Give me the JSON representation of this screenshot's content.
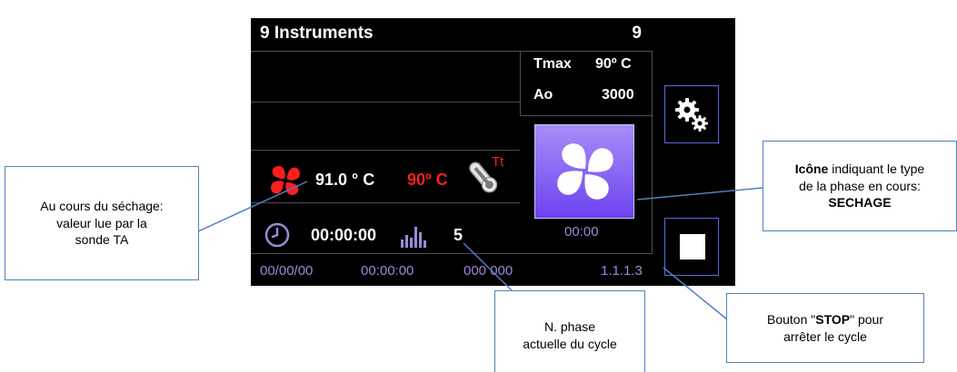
{
  "screen": {
    "title": "9 Instruments",
    "count": "9",
    "tmax_label": "Tmax",
    "tmax_value": "90º C",
    "ao_label": "Ao",
    "ao_value": "3000",
    "phase_time": "00:00",
    "temp_read": "91.0 ° C",
    "temp_set": "90º C",
    "probe_label": "Tt",
    "cycle_time": "00:00:00",
    "phase_number": "5",
    "status_date": "00/00/00",
    "status_time": "00:00:00",
    "status_counter": "000 000",
    "status_version": "1.1.1.3",
    "accent_color": "#7b54f4",
    "temp_icon_color": "#ff1e1e"
  },
  "icons": {
    "phase": "fan-drying-icon",
    "gear": "gears-icon",
    "stop": "stop-square-icon",
    "clock": "clock-icon",
    "bars": "bar-chart-icon",
    "probe": "thermometer-probe-icon"
  },
  "callouts": {
    "probe": {
      "line1": "Au cours du séchage:",
      "line2": "valeur lue par la",
      "line3": "sonde TA"
    },
    "icon": {
      "bold1": "Icône",
      "line1": " indiquant le type",
      "line2": "de la phase en cours:",
      "bold2": "SECHAGE"
    },
    "stop": {
      "line1a": "Bouton \"",
      "bold": "STOP",
      "line1b": "\" pour",
      "line2": "arrêter le cycle"
    },
    "phase": {
      "line1": "N. phase",
      "line2": "actuelle du cycle"
    }
  }
}
